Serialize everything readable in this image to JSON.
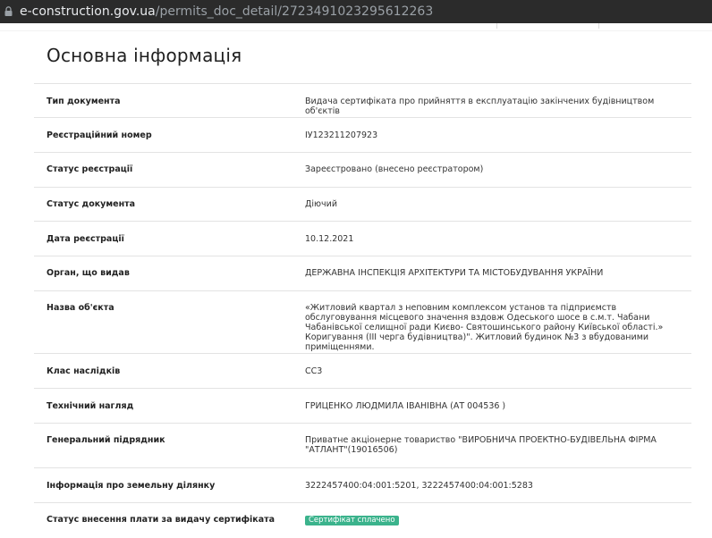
{
  "browser": {
    "url_domain": "e-construction.gov.ua",
    "url_path": "/permits_doc_detail/2723491023295612263"
  },
  "main": {
    "title": "Основна інформація",
    "rows": [
      {
        "label": "Тип документа",
        "value": "Видача сертифіката про прийняття в експлуатацію закінчених будівництвом об'єктів"
      },
      {
        "label": "Реєстраційний номер",
        "value": "ІУ123211207923"
      },
      {
        "label": "Статус реєстрації",
        "value": "Зареєстровано (внесено реєстратором)"
      },
      {
        "label": "Статус документа",
        "value": "Діючий"
      },
      {
        "label": "Дата реєстрації",
        "value": "10.12.2021"
      },
      {
        "label": "Орган, що видав",
        "value": "ДЕРЖАВНА ІНСПЕКЦІЯ АРХІТЕКТУРИ ТА МІСТОБУДУВАННЯ УКРАЇНИ"
      },
      {
        "label": "Назва об'єкта",
        "value": "«Житловий квартал з неповним комплексом установ та підприємств обслуговування місцевого значення вздовж Одеського шосе в с.м.т. Чабани Чабанівської селищної ради Києво- Святошинського району Київської області.» Коригування (ІІІ черга будівництва)\". Житловий будинок №3 з вбудованими приміщеннями."
      },
      {
        "label": "Клас наслідків",
        "value": "СС3"
      },
      {
        "label": "Технічний нагляд",
        "value": "ГРИЦЕНКО ЛЮДМИЛА ІВАНІВНА (АТ 004536 )"
      },
      {
        "label": "Генеральний підрядник",
        "value": "Приватне акціонерне товариство \"ВИРОБНИЧА ПРОЕКТНО-БУДІВЕЛЬНА ФІРМА \"АТЛАНТ\"(19016506)"
      },
      {
        "label": "Інформація про земельну ділянку",
        "value": "3222457400:04:001:5201, 3222457400:04:001:5283"
      },
      {
        "label": "Статус внесення плати за видачу сертифіката",
        "badge": "Сертифікат сплачено"
      }
    ]
  },
  "colors": {
    "badge_bg": "#3bb38c",
    "urlbar_bg": "#2b2b2b"
  }
}
